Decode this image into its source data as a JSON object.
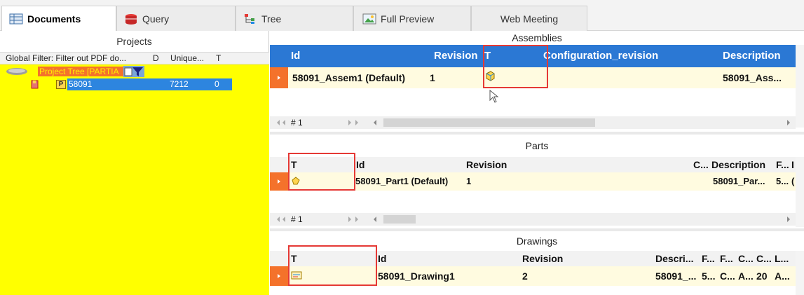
{
  "tabs": [
    {
      "label": "Documents",
      "icon": "grid-table-icon",
      "active": true
    },
    {
      "label": "Query",
      "icon": "database-icon",
      "active": false
    },
    {
      "label": "Tree",
      "icon": "tree-icon",
      "active": false
    },
    {
      "label": "Full Preview",
      "icon": "image-icon",
      "active": false
    },
    {
      "label": "Web Meeting",
      "icon": "",
      "active": false
    }
  ],
  "projects": {
    "title": "Projects",
    "filter_label": "Global Filter: Filter out PDF do...",
    "col_d": "D",
    "col_unique": "Unique...",
    "col_t": "T",
    "tree_root": "Project Tree [PARTIA",
    "node": {
      "id": "58091",
      "unique": "7212",
      "t": "0",
      "badge": "P"
    }
  },
  "assemblies": {
    "title": "Assemblies",
    "headers": {
      "id": "Id",
      "revision": "Revision",
      "t": "T",
      "config_rev": "Configuration_revision",
      "description": "Description"
    },
    "row": {
      "id": "58091_Assem1 (Default)",
      "revision": "1",
      "description": "58091_Ass..."
    },
    "nav": {
      "record": "# 1"
    }
  },
  "parts": {
    "title": "Parts",
    "headers": {
      "t": "T",
      "id": "Id",
      "revision": "Revision",
      "c": "C...",
      "description": "Description",
      "f": "F...",
      "extra": "I"
    },
    "row": {
      "id": "58091_Part1 (Default)",
      "revision": "1",
      "description": "58091_Par...",
      "f": "5...",
      "extra": "("
    },
    "nav": {
      "record": "# 1"
    }
  },
  "drawings": {
    "title": "Drawings",
    "headers": {
      "t": "T",
      "id": "Id",
      "revision": "Revision",
      "descri": "Descri...",
      "f1": "F...",
      "f2": "F...",
      "c1": "C...",
      "c2": "C...",
      "l": "L..."
    },
    "row": {
      "id": "58091_Drawing1",
      "revision": "2",
      "descri": "58091_...",
      "f1": "5...",
      "f2": "C...",
      "c1": "A...",
      "c2": "20",
      "l": "A..."
    }
  },
  "colors": {
    "accent_blue": "#2b78d4",
    "selected_blue": "#2d85df",
    "marker_orange": "#f4722b",
    "highlight_box": "#e53935",
    "tree_bg": "#ffff00",
    "row_bg": "#fffbe0"
  }
}
